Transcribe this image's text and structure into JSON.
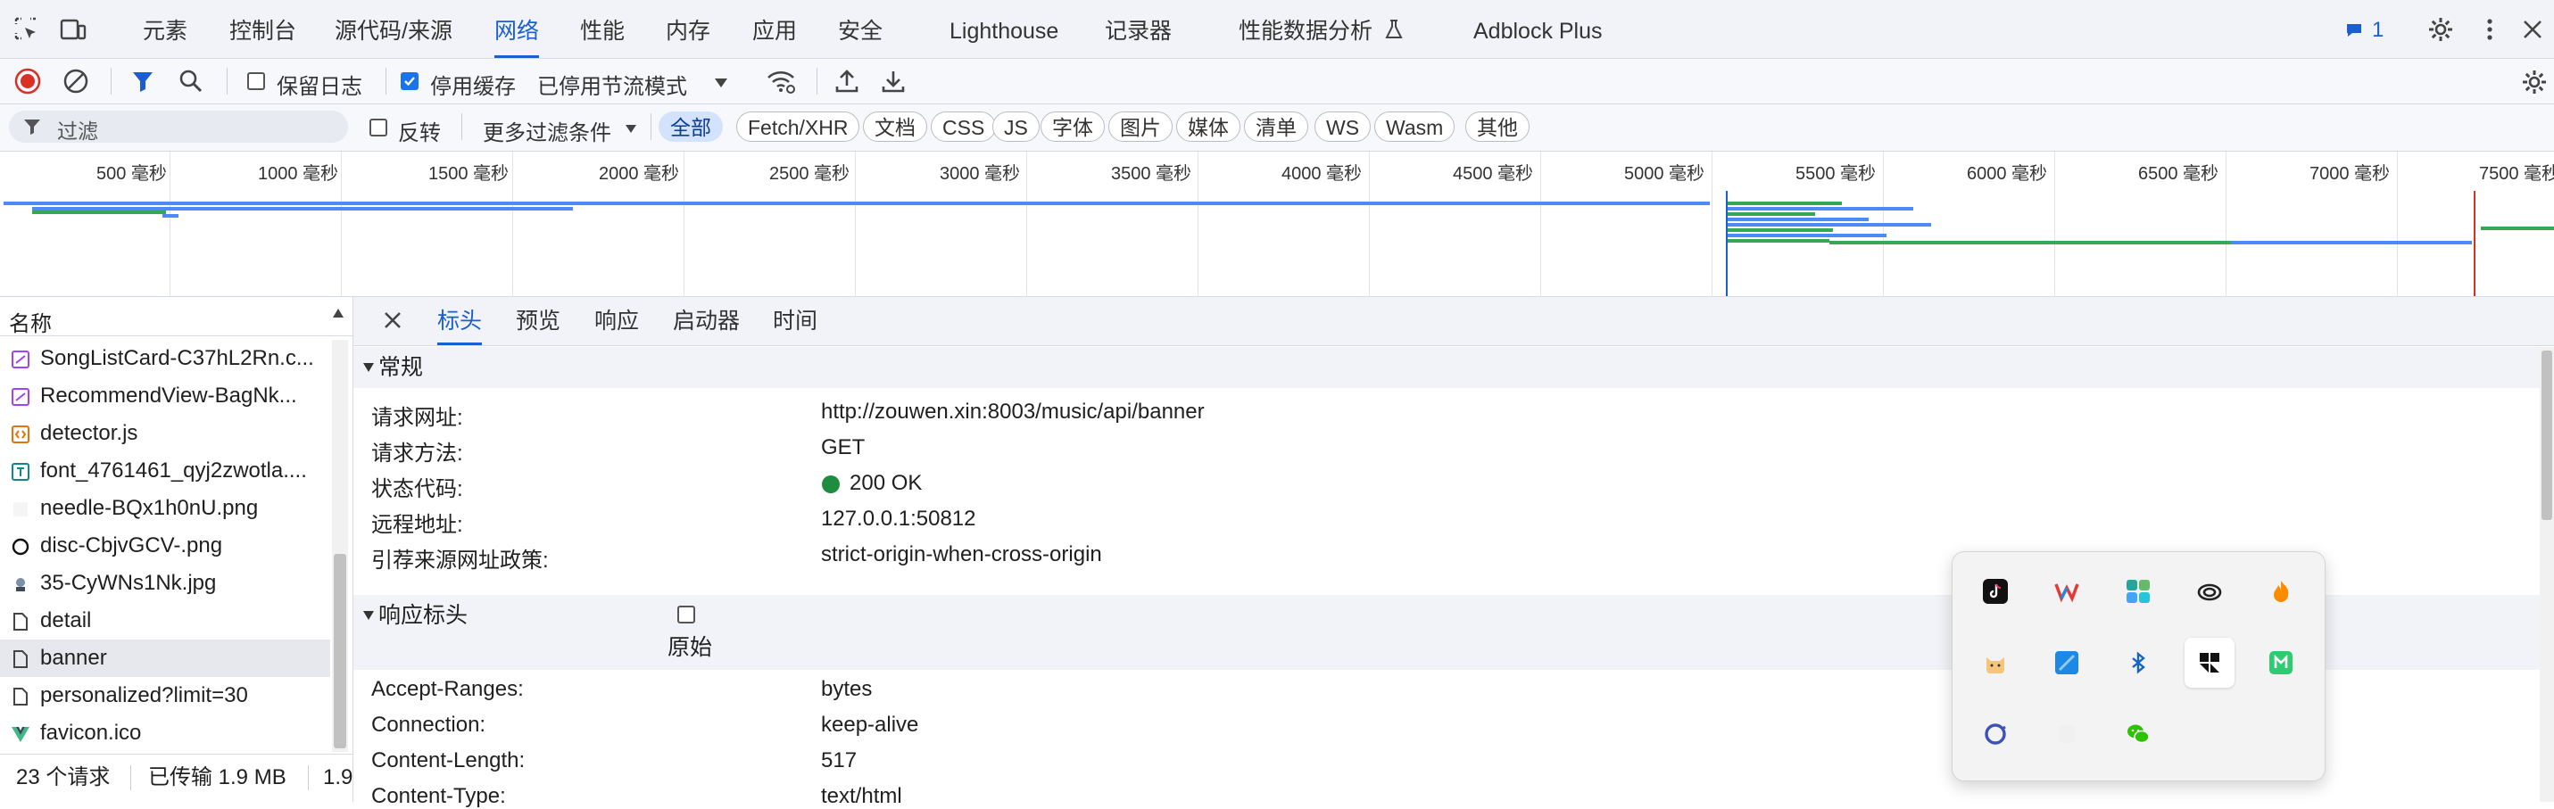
{
  "tabs": [
    "元素",
    "控制台",
    "源代码/来源",
    "网络",
    "性能",
    "内存",
    "应用",
    "安全",
    "Lighthouse",
    "记录器",
    "性能数据分析",
    "Adblock Plus"
  ],
  "active_tab": "网络",
  "issues_badge": "1",
  "toolbar": {
    "preserve_log": "保留日志",
    "disable_cache": "停用缓存",
    "throttle": "已停用节流模式"
  },
  "filter": {
    "placeholder": "过滤",
    "invert": "反转",
    "more_filters": "更多过滤条件",
    "types": [
      "全部",
      "Fetch/XHR",
      "文档",
      "CSS",
      "JS",
      "字体",
      "图片",
      "媒体",
      "清单",
      "WS",
      "Wasm",
      "其他"
    ]
  },
  "overview": {
    "ticks": [
      "500 毫秒",
      "1000 毫秒",
      "1500 毫秒",
      "2000 毫秒",
      "2500 毫秒",
      "3000 毫秒",
      "3500 毫秒",
      "4000 毫秒",
      "4500 毫秒",
      "5000 毫秒",
      "5500 毫秒",
      "6000 毫秒",
      "6500 毫秒",
      "7000 毫秒",
      "7500 毫秒"
    ]
  },
  "requests": {
    "header": "名称",
    "items": [
      {
        "name": "SongListCard-C37hL2Rn.c...",
        "icon": "css-file-icon"
      },
      {
        "name": "RecommendView-BagNk...",
        "icon": "css-file-icon"
      },
      {
        "name": "detector.js",
        "icon": "script-file-icon"
      },
      {
        "name": "font_4761461_qyj2zwotla....",
        "icon": "font-file-icon"
      },
      {
        "name": "needle-BQx1h0nU.png",
        "icon": "image-file-icon"
      },
      {
        "name": "disc-CbjvGCV-.png",
        "icon": "image-file-icon"
      },
      {
        "name": "35-CyWNs1Nk.jpg",
        "icon": "image-file-icon"
      },
      {
        "name": "detail",
        "icon": "document-icon"
      },
      {
        "name": "banner",
        "icon": "document-icon",
        "selected": true
      },
      {
        "name": "personalized?limit=30",
        "icon": "document-icon"
      },
      {
        "name": "favicon.ico",
        "icon": "vue-favicon-icon"
      }
    ]
  },
  "status": {
    "requests": "23 个请求",
    "transferred": "已传输 1.9 MB",
    "resources": "1.9"
  },
  "detail_tabs": [
    "标头",
    "预览",
    "响应",
    "启动器",
    "时间"
  ],
  "general": {
    "title": "常规",
    "rows": [
      {
        "k": "请求网址:",
        "v": "http://zouwen.xin:8003/music/api/banner"
      },
      {
        "k": "请求方法:",
        "v": "GET"
      },
      {
        "k": "状态代码:",
        "v": "200 OK"
      },
      {
        "k": "远程地址:",
        "v": "127.0.0.1:50812"
      },
      {
        "k": "引荐来源网址政策:",
        "v": "strict-origin-when-cross-origin"
      }
    ]
  },
  "response_headers": {
    "title": "响应标头",
    "raw_label": "原始",
    "rows": [
      {
        "k": "Accept-Ranges:",
        "v": "bytes"
      },
      {
        "k": "Connection:",
        "v": "keep-alive"
      },
      {
        "k": "Content-Length:",
        "v": "517"
      },
      {
        "k": "Content-Type:",
        "v": "text/html"
      }
    ]
  },
  "colors": {
    "accent": "#1a5fd1",
    "record": "#d93025",
    "status_ok": "#1e8e3e",
    "bar_blue": "#4c8bf5",
    "bar_green": "#34a853"
  },
  "tray_icons": [
    "tiktok-icon",
    "wps-icon",
    "app-grid-icon",
    "creative-cloud-icon",
    "fire-shield-icon",
    "cat-icon",
    "blue-app-icon",
    "bluetooth-icon",
    "pinned-app-icon",
    "green-app-icon",
    "sync-ring-icon",
    "blank-icon",
    "wechat-icon"
  ]
}
